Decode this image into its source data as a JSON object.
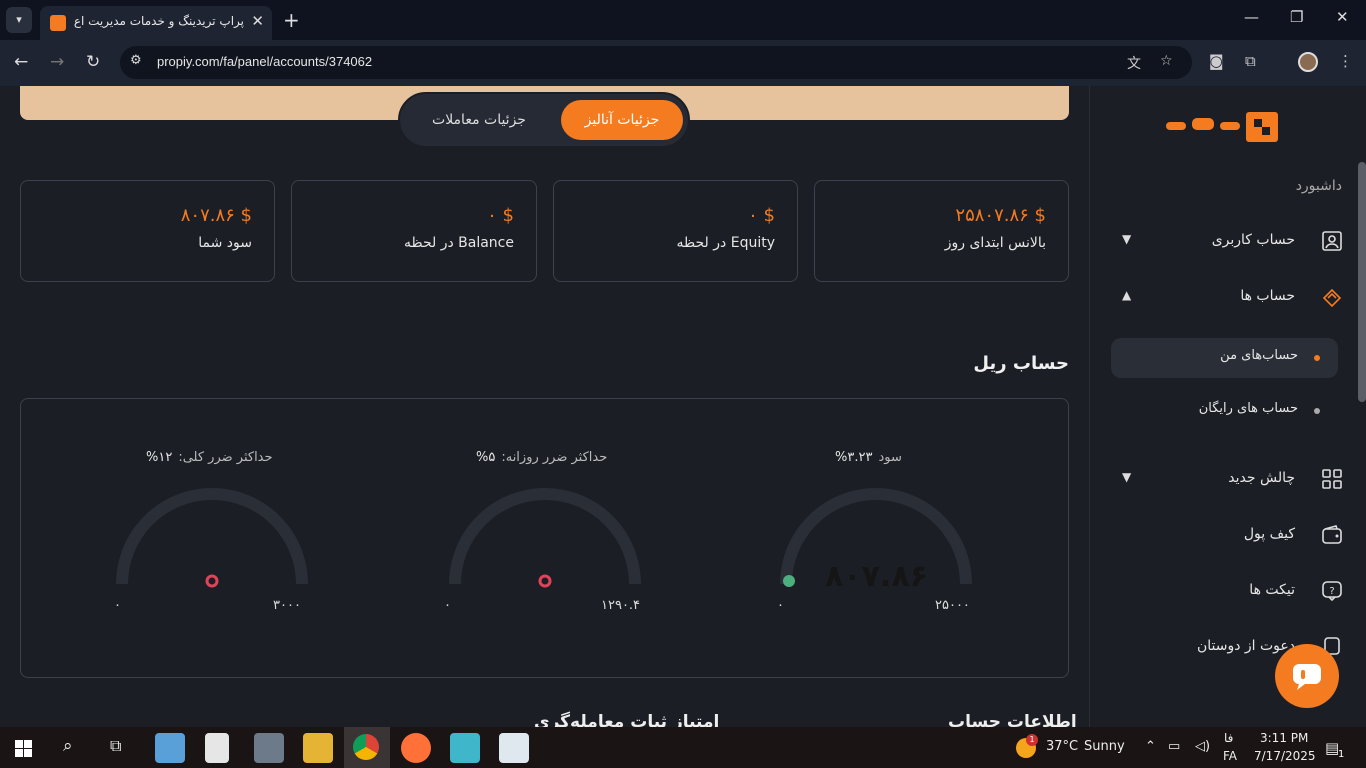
{
  "browser": {
    "tab_title": "پراپ تریدینگ و خدمات مدیریت اع",
    "url": "propiy.com/fa/panel/accounts/374062"
  },
  "switch": {
    "active_label": "جزئیات آنالیز",
    "idle_label": "جزئیات معاملات"
  },
  "cards": [
    {
      "value": "$ ۲۵۸۰۷.۸۶",
      "label": "بالانس ابتدای روز"
    },
    {
      "value": "$ ۰",
      "label": "Equity در لحظه"
    },
    {
      "value": "$ ۰",
      "label": "Balance در لحظه"
    },
    {
      "value": "$ ۸۰۷.۸۶",
      "label": "سود شما"
    }
  ],
  "section_title": "حساب ریل",
  "gauges": [
    {
      "label": "سود",
      "value_text": "۳.۲۳%",
      "min": "۰",
      "max": "۲۵۰۰۰",
      "center_value": "۸۰۷.۸۶",
      "level": 0.0323
    },
    {
      "label": "حداکثر ضرر روزانه:",
      "value_text": "۵%",
      "min": "۰",
      "max": "۱۲۹۰.۴",
      "level": 0
    },
    {
      "label": "حداکثر ضرر کلی:",
      "value_text": "۱۲%",
      "min": "۰",
      "max": "۳۰۰۰",
      "level": 0
    }
  ],
  "bottom": {
    "right_title": "اطلاعات حساب",
    "left_title": "امتیاز ثبات معامله‌گری"
  },
  "sidebar": {
    "dashboard": "داشبورد",
    "items": [
      {
        "label": "حساب کاربری"
      },
      {
        "label": "حساب ها"
      },
      {
        "label": "چالش جدید"
      },
      {
        "label": "کیف پول"
      },
      {
        "label": "تیکت ها"
      },
      {
        "label": "دعوت از دوستان"
      }
    ],
    "sub_items": [
      {
        "label": "حساب‌های من"
      },
      {
        "label": "حساب های رایگان"
      }
    ]
  },
  "chat_badge": "",
  "taskbar": {
    "weather_temp": "37°C",
    "weather_text": "Sunny",
    "lang_top": "فا",
    "lang_bottom": "FA",
    "time": "3:11 PM",
    "date": "7/17/2025",
    "notif_count": "1",
    "weather_badge": "1"
  },
  "colors": {
    "accent": "#f47b20",
    "banner": "#e7c39d",
    "danger": "#e0435a",
    "success": "#4caf7d"
  }
}
